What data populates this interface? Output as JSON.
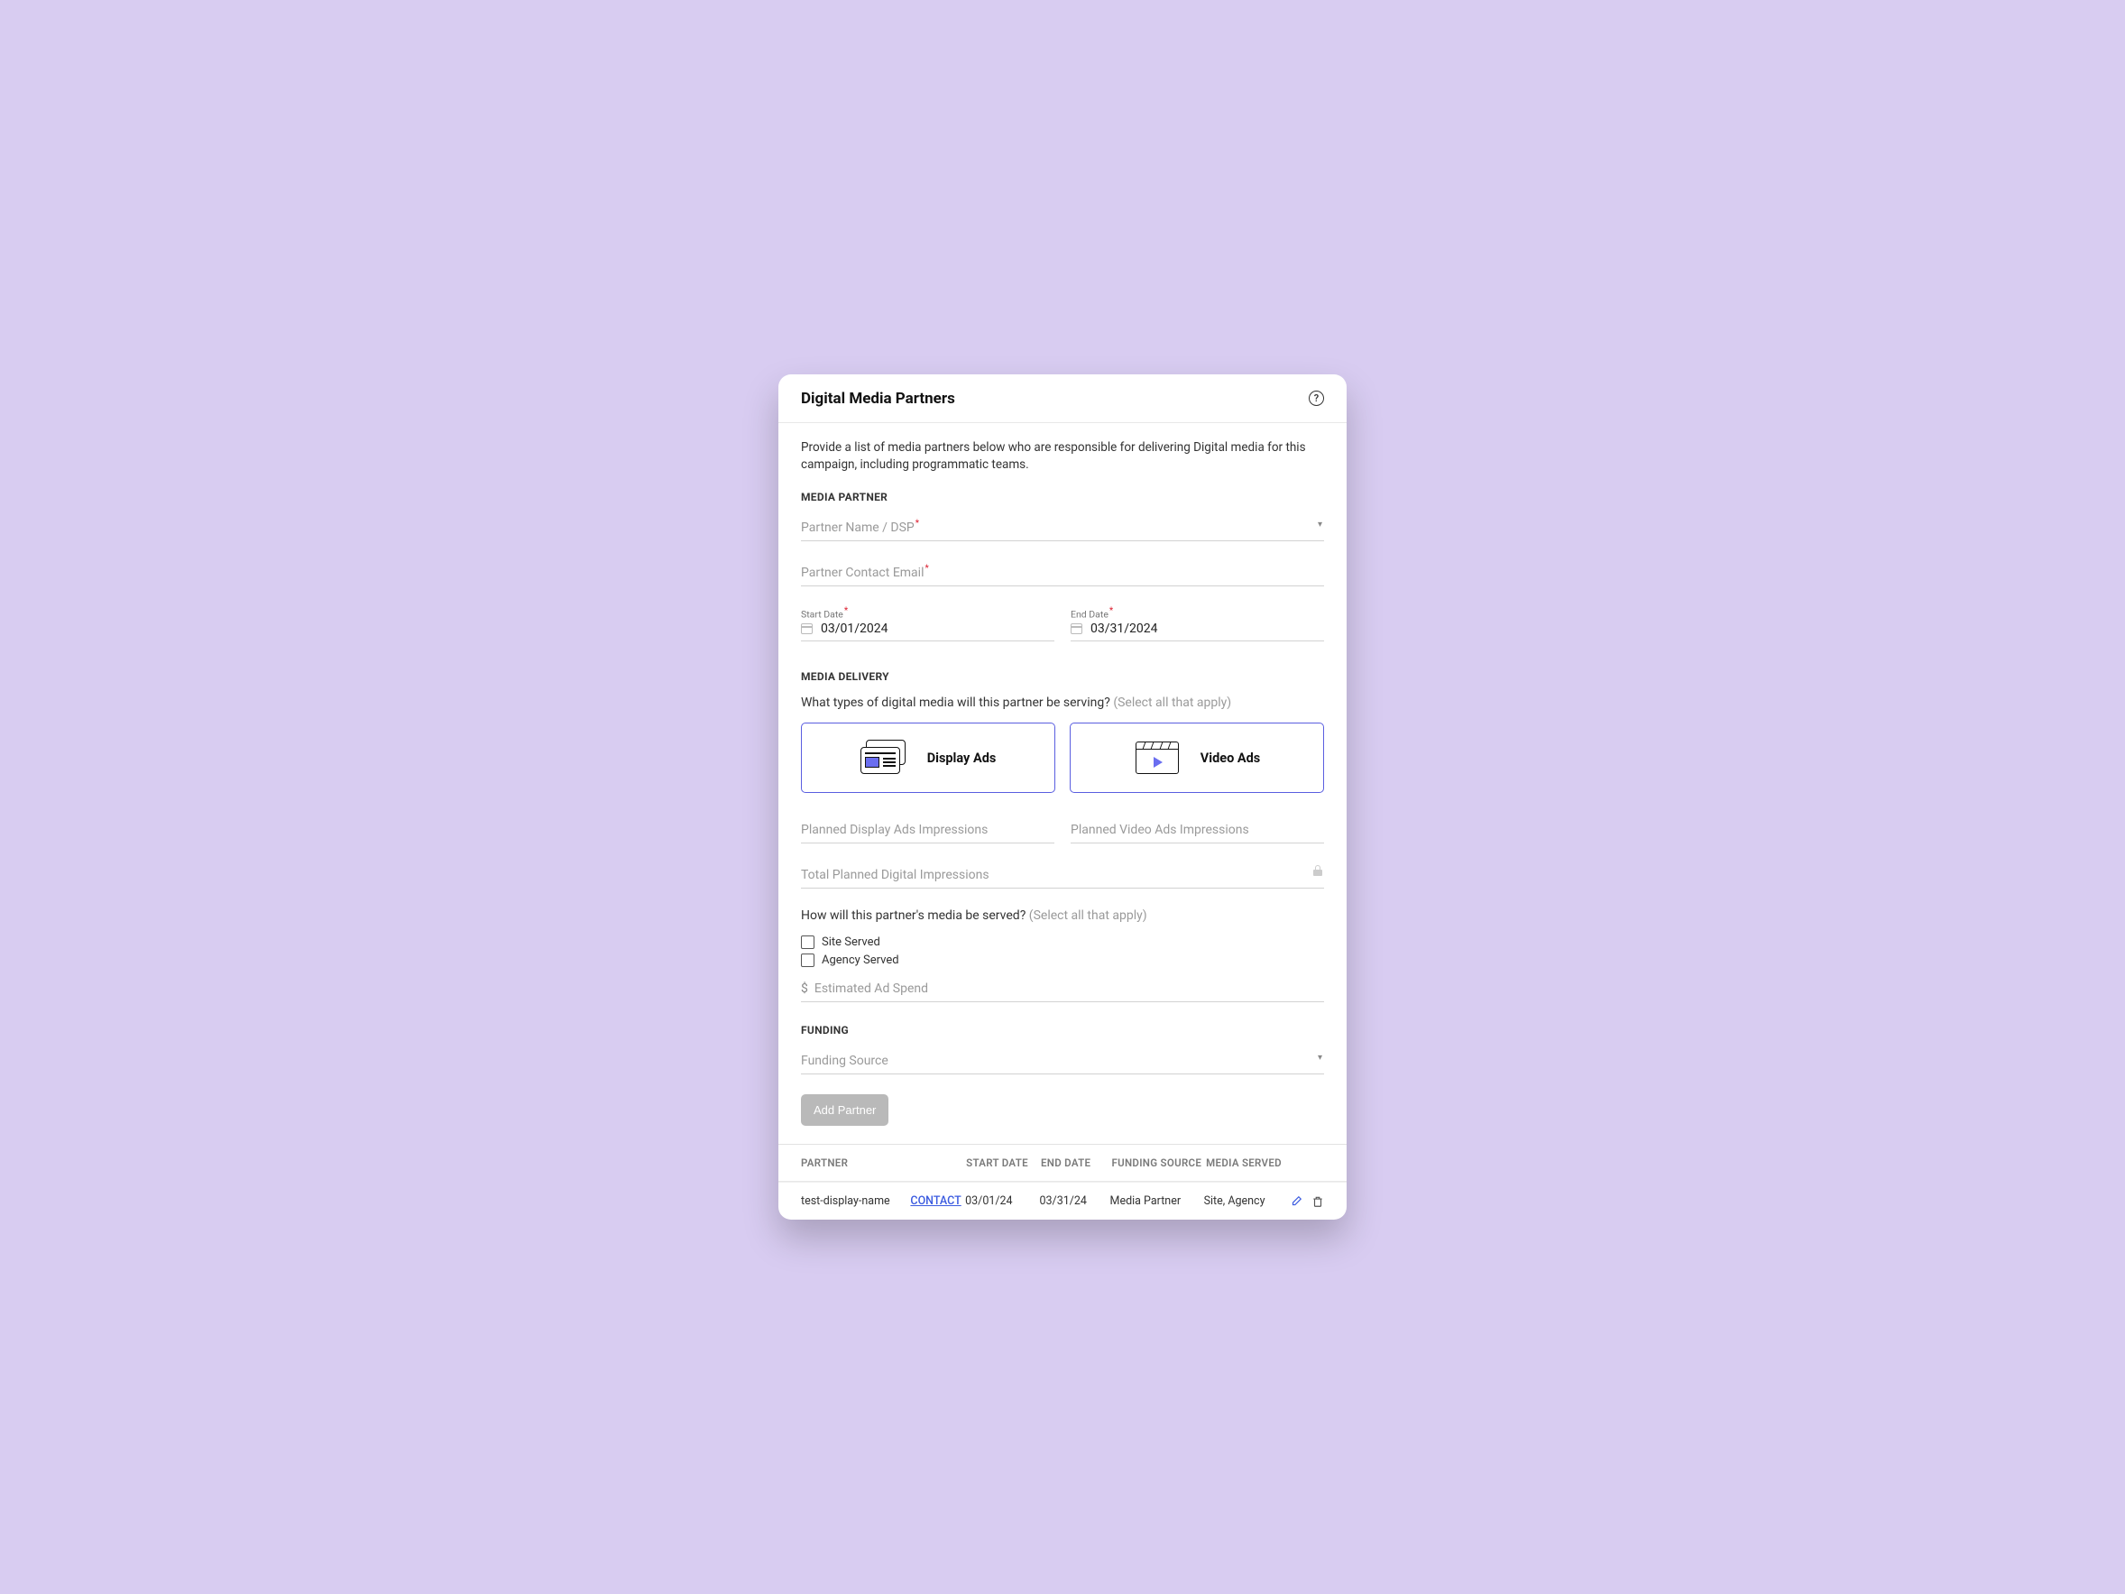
{
  "header": {
    "title": "Digital Media Partners"
  },
  "intro": "Provide a list of media partners below who are responsible for delivering Digital media for this campaign, including programmatic teams.",
  "sections": {
    "media_partner": "MEDIA PARTNER",
    "media_delivery": "MEDIA DELIVERY",
    "funding": "FUNDING"
  },
  "fields": {
    "partner_name": "Partner Name / DSP",
    "contact_email": "Partner Contact Email",
    "start_date_label": "Start Date",
    "start_date_value": "03/01/2024",
    "end_date_label": "End Date",
    "end_date_value": "03/31/2024",
    "media_type_q": "What types of digital media will this partner be serving?",
    "select_hint": "(Select all that apply)",
    "tile_display": "Display Ads",
    "tile_video": "Video Ads",
    "planned_display": "Planned Display Ads Impressions",
    "planned_video": "Planned Video Ads Impressions",
    "total_planned": "Total Planned Digital Impressions",
    "serve_q": "How will this partner's media be served?",
    "site_served": "Site Served",
    "agency_served": "Agency Served",
    "est_spend": "Estimated Ad Spend",
    "funding_source": "Funding Source",
    "add_btn": "Add Partner"
  },
  "table": {
    "headers": {
      "partner": "PARTNER",
      "start": "START DATE",
      "end": "END DATE",
      "funding": "FUNDING SOURCE",
      "media": "MEDIA SERVED"
    },
    "rows": [
      {
        "partner": "test-display-name",
        "contact": "CONTACT",
        "start": "03/01/24",
        "end": "03/31/24",
        "funding": "Media Partner",
        "media": "Site, Agency"
      }
    ]
  }
}
